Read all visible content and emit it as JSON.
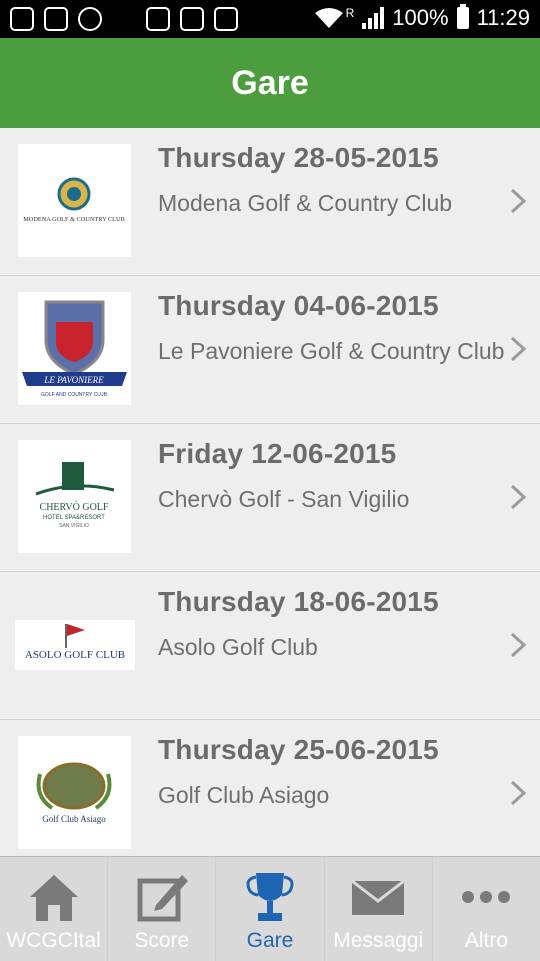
{
  "status_bar": {
    "battery": "100%",
    "time": "11:29",
    "roaming": "R"
  },
  "header": {
    "title": "Gare"
  },
  "events": [
    {
      "date": "Thursday 28-05-2015",
      "club": "Modena Golf & Country Club",
      "logo_icon": "modena-golf-logo"
    },
    {
      "date": "Thursday 04-06-2015",
      "club": "Le Pavoniere Golf & Country Club",
      "logo_icon": "le-pavoniere-logo"
    },
    {
      "date": "Friday 12-06-2015",
      "club": "Chervò Golf - San Vigilio",
      "logo_icon": "chervo-golf-logo"
    },
    {
      "date": "Thursday 18-06-2015",
      "club": "Asolo Golf Club",
      "logo_icon": "asolo-golf-logo"
    },
    {
      "date": "Thursday 25-06-2015",
      "club": "Golf Club Asiago",
      "logo_icon": "asiago-golf-logo"
    }
  ],
  "logos": {
    "modena": "MODENA GOLF & COUNTRY CLUB",
    "pavoniere": "LE PAVONIERE",
    "pavoniere_sub": "GOLF AND COUNTRY CLUB",
    "chervo": "CHERVÒ GOLF",
    "chervo_sub": "HOTEL SPA&RESORT",
    "chervo_sub2": "SAN VIGILIO",
    "asolo": "ASOLO GOLF CLUB",
    "asiago": "Golf Club Asiago"
  },
  "tabs": [
    {
      "label": "WCGCItal",
      "icon": "home-icon"
    },
    {
      "label": "Score",
      "icon": "edit-icon"
    },
    {
      "label": "Gare",
      "icon": "trophy-icon",
      "active": true
    },
    {
      "label": "Messaggi",
      "icon": "envelope-icon"
    },
    {
      "label": "Altro",
      "icon": "more-icon"
    }
  ],
  "colors": {
    "header_green": "#4c9d3d",
    "active_tab": "#1e65b4"
  }
}
